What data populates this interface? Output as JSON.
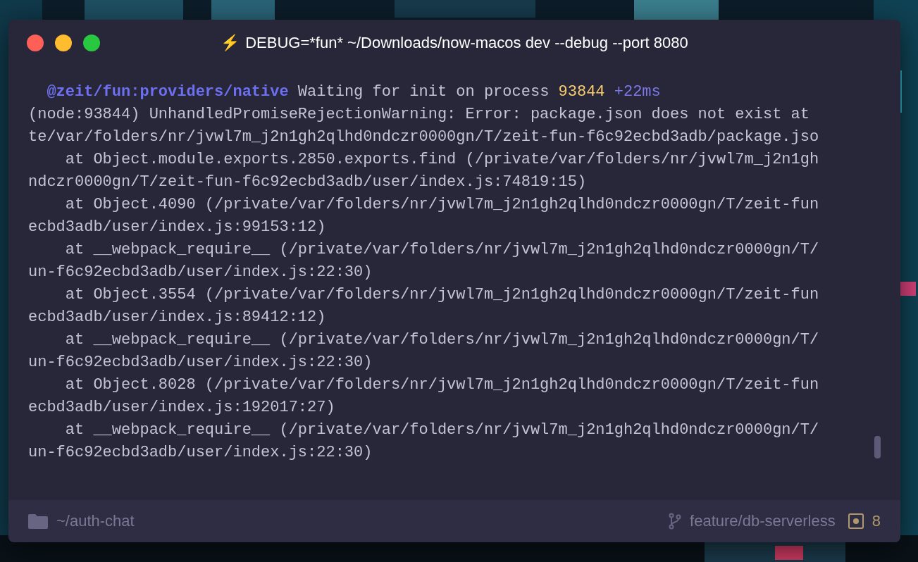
{
  "window": {
    "title": "DEBUG=*fun* ~/Downloads/now-macos dev --debug --port 8080",
    "title_icon": "⚡"
  },
  "terminal": {
    "lines": [
      {
        "segments": [
          {
            "kind": "namespace",
            "text": "  @zeit/fun:providers/native"
          },
          {
            "kind": "plain",
            "text": " Waiting for init on process "
          },
          {
            "kind": "number",
            "text": "93844"
          },
          {
            "kind": "delta",
            "text": " +22ms"
          }
        ]
      },
      {
        "segments": [
          {
            "kind": "plain",
            "text": "(node:93844) UnhandledPromiseRejectionWarning: Error: package.json does not exist at"
          }
        ]
      },
      {
        "segments": [
          {
            "kind": "plain",
            "text": "te/var/folders/nr/jvwl7m_j2n1gh2qlhd0ndczr0000gn/T/zeit-fun-f6c92ecbd3adb/package.jso"
          }
        ]
      },
      {
        "segments": [
          {
            "kind": "plain",
            "text": "    at Object.module.exports.2850.exports.find (/private/var/folders/nr/jvwl7m_j2n1gh"
          }
        ]
      },
      {
        "segments": [
          {
            "kind": "plain",
            "text": "ndczr0000gn/T/zeit-fun-f6c92ecbd3adb/user/index.js:74819:15)"
          }
        ]
      },
      {
        "segments": [
          {
            "kind": "plain",
            "text": "    at Object.4090 (/private/var/folders/nr/jvwl7m_j2n1gh2qlhd0ndczr0000gn/T/zeit-fun"
          }
        ]
      },
      {
        "segments": [
          {
            "kind": "plain",
            "text": "ecbd3adb/user/index.js:99153:12)"
          }
        ]
      },
      {
        "segments": [
          {
            "kind": "plain",
            "text": "    at __webpack_require__ (/private/var/folders/nr/jvwl7m_j2n1gh2qlhd0ndczr0000gn/T/"
          }
        ]
      },
      {
        "segments": [
          {
            "kind": "plain",
            "text": "un-f6c92ecbd3adb/user/index.js:22:30)"
          }
        ]
      },
      {
        "segments": [
          {
            "kind": "plain",
            "text": "    at Object.3554 (/private/var/folders/nr/jvwl7m_j2n1gh2qlhd0ndczr0000gn/T/zeit-fun"
          }
        ]
      },
      {
        "segments": [
          {
            "kind": "plain",
            "text": "ecbd3adb/user/index.js:89412:12)"
          }
        ]
      },
      {
        "segments": [
          {
            "kind": "plain",
            "text": "    at __webpack_require__ (/private/var/folders/nr/jvwl7m_j2n1gh2qlhd0ndczr0000gn/T/"
          }
        ]
      },
      {
        "segments": [
          {
            "kind": "plain",
            "text": "un-f6c92ecbd3adb/user/index.js:22:30)"
          }
        ]
      },
      {
        "segments": [
          {
            "kind": "plain",
            "text": "    at Object.8028 (/private/var/folders/nr/jvwl7m_j2n1gh2qlhd0ndczr0000gn/T/zeit-fun"
          }
        ]
      },
      {
        "segments": [
          {
            "kind": "plain",
            "text": "ecbd3adb/user/index.js:192017:27)"
          }
        ]
      },
      {
        "segments": [
          {
            "kind": "plain",
            "text": "    at __webpack_require__ (/private/var/folders/nr/jvwl7m_j2n1gh2qlhd0ndczr0000gn/T/"
          }
        ]
      },
      {
        "segments": [
          {
            "kind": "plain",
            "text": "un-f6c92ecbd3adb/user/index.js:22:30)"
          }
        ]
      }
    ]
  },
  "status_bar": {
    "directory": "~/auth-chat",
    "branch": "feature/db-serverless",
    "changes": "8"
  }
}
